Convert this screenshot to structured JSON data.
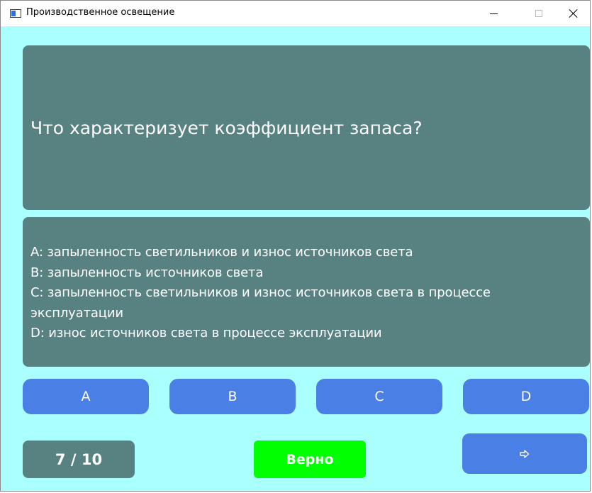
{
  "window": {
    "title": "Производственное освещение"
  },
  "question": {
    "text": "Что характеризует коэффициент запаса?"
  },
  "answers": [
    "A: запыленность светильников и износ источников света",
    "B: запыленность источников света",
    "C: запыленность светильников и износ источников света в процессе",
    "эксплуатации",
    "D: износ источников света в процессе эксплуатации"
  ],
  "choices": {
    "a": "A",
    "b": "B",
    "c": "C",
    "d": "D"
  },
  "status": {
    "progress": "7 / 10",
    "result": "Верно"
  },
  "icons": {
    "app": "app-window-icon",
    "next": "arrow-right-icon"
  },
  "colors": {
    "background": "#aaffff",
    "panel": "#588281",
    "button": "#4a7fe6",
    "correct": "#00ff00"
  }
}
